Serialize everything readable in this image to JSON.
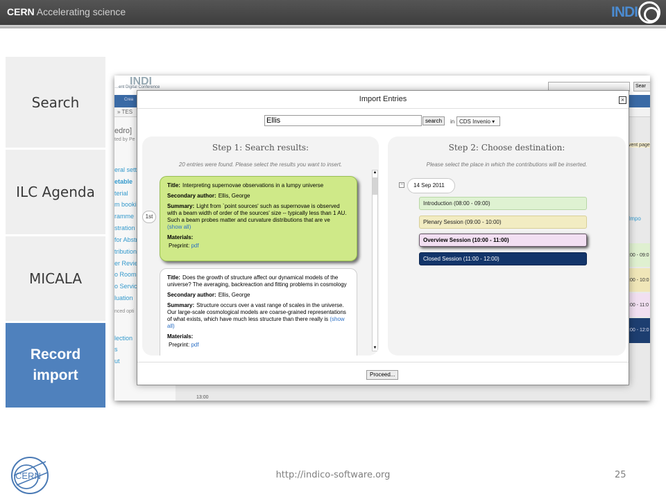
{
  "header": {
    "brand_bold": "CERN",
    "brand_tagline": "Accelerating science",
    "logo_text": "INDI"
  },
  "nav": {
    "items": [
      {
        "label": "Search"
      },
      {
        "label": "ILC Agenda"
      },
      {
        "label": "MICALA"
      },
      {
        "label": "Record import",
        "label_line1": "Record",
        "label_line2": "import",
        "active": true
      }
    ]
  },
  "background_app": {
    "logo": "INDI",
    "subtitle": "…ent Digital Conference",
    "nav_item": "Crea",
    "crumb": "» TES",
    "search_button": "Sear",
    "title_fragment": "edro]",
    "subtitle_fragment": "ted by Pe",
    "left_menu": [
      "eral setti",
      "etable",
      "terial",
      "m booking",
      "ramme",
      "stration",
      "for Abstr",
      "tributions",
      "er Review",
      "o Rooms",
      "o Service",
      "luation",
      "nced opti",
      "lection",
      "s",
      "ut"
    ],
    "right_labels": [
      "vent page",
      "Impo",
      ":00 - 09:0",
      ":00 - 10:0",
      ":00 - 11:0",
      ":00 - 12:0"
    ],
    "time_label": "13:00"
  },
  "dialog": {
    "title": "Import Entries",
    "close_glyph": "×",
    "search_value": "Ellis",
    "search_button": "search",
    "in_label": "in",
    "source_value": "CDS Invenio",
    "proceed_button": "Proceed...",
    "step1": {
      "title": "Step 1: Search results:",
      "subtitle": "20 entries were found. Please select the results you want to insert.",
      "rank_label": "1st",
      "results": [
        {
          "title_label": "Title:",
          "title": "Interpreting supernovae observations in a lumpy universe",
          "author_label": "Secondary author:",
          "author": "Ellis, George",
          "summary_label": "Summary:",
          "summary": "Light from `point sources' such as supernovae is observed with a beam width of order of the sources' size -- typically less than 1 AU. Such a beam probes matter and curvature distributions that are ve",
          "show_all": "(show all)",
          "materials_label": "Materials:",
          "material_name": "Preprint:",
          "material_link": "pdf"
        },
        {
          "title_label": "Title:",
          "title": "Does the growth of structure affect our dynamical models of the universe? The averaging, backreaction and fitting problems in cosmology",
          "author_label": "Secondary author:",
          "author": "Ellis, George",
          "summary_label": "Summary:",
          "summary": "Structure occurs over a vast range of scales in the universe. Our large-scale cosmological models are coarse-grained representations of what exists, which have much less structure than there really is",
          "show_all": "(show all)",
          "materials_label": "Materials:",
          "material_name": "Preprint:",
          "material_link": "pdf"
        }
      ]
    },
    "step2": {
      "title": "Step 2: Choose destination:",
      "subtitle": "Please select the place in which the contributions will be inserted.",
      "toggle": "−",
      "date": "14 Sep 2011",
      "sessions": [
        {
          "label": "Introduction (08:00 - 09:00)",
          "color": "#dff2d2"
        },
        {
          "label": "Plenary Session (09:00 - 10:00)",
          "color": "#f2ecc2"
        },
        {
          "label": "Overview Session (10:00 - 11:00)",
          "color": "#f2dff2",
          "selected": true
        },
        {
          "label": "Closed Session (11:00 - 12:00)",
          "color": "#13356a"
        }
      ]
    }
  },
  "footer": {
    "url": "http://indico-software.org",
    "page_number": "25",
    "logo_text": "CERN"
  },
  "colors": {
    "accent": "#4f81bd",
    "header_bg": "#454545",
    "selected_card": "#cfe988"
  }
}
